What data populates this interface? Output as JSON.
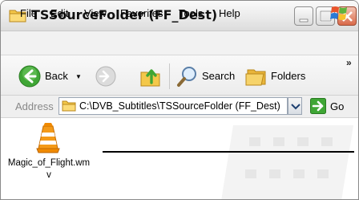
{
  "window": {
    "title": "TSSourceFolder (FF_Dest)"
  },
  "menu": {
    "items": [
      {
        "label": "File"
      },
      {
        "label": "Edit"
      },
      {
        "label": "View"
      },
      {
        "label": "Favorites"
      },
      {
        "label": "Tools"
      },
      {
        "label": "Help"
      }
    ]
  },
  "toolbar": {
    "back_label": "Back",
    "search_label": "Search",
    "folders_label": "Folders",
    "overflow": "»"
  },
  "address": {
    "label": "Address",
    "path": "C:\\DVB_Subtitles\\TSSourceFolder (FF_Dest)",
    "go_label": "Go"
  },
  "files": [
    {
      "name": "Magic_of_Flight.wmv",
      "icon": "vlc-cone-icon"
    }
  ],
  "colors": {
    "go_green": "#3fa635",
    "vlc_orange": "#f08a00",
    "folder_yellow": "#f4c84a"
  }
}
